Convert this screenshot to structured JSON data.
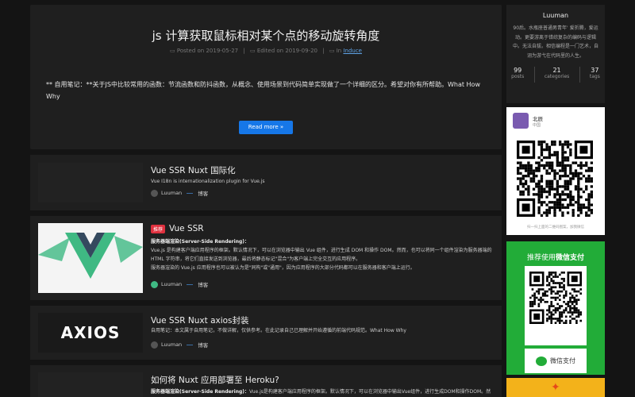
{
  "featured": {
    "title": "js 计算获取鼠标相对某个点的移动旋转角度",
    "posted_label": "Posted on",
    "posted_date": "2019-05-27",
    "edited_label": "Edited on",
    "edited_date": "2019-09-20",
    "in_label": "In",
    "category": "Induce",
    "excerpt": "** 自用笔记：**关于JS中比较常用的函数：节流函数和防抖函数，从概念、使用场景到代码简单实现做了一个详细的区分。希望对你有所帮助。What How Why",
    "more_label": "Read more »"
  },
  "posts": [
    {
      "title": "Vue SSR Nuxt 国际化",
      "subtitle": "Vue I18n is internationalization plugin for Vue.js",
      "author": "Luuman",
      "category": "博客"
    },
    {
      "badge": "推荐",
      "title": "Vue SSR",
      "subtitle_bold": "服务器端渲染(Server-Side Rendering)：",
      "subtitle_lines": [
        "Vue.js 是构建客户端应用程序的框架。默认情况下，可以在浏览器中输出 Vue 组件，进行生成 DOM 和操作 DOM。然而，也可以将同一个组件渲染为服务器端的 HTML 字符串，将它们直接发送到浏览器，最后将静态标记\"混合\"为客户端上完全交互的应用程序。",
        "服务器渲染的 Vue.js 应用程序也可以被认为是\"同构\"或\"通用\"，因为应用程序的大部分代码都可以在服务器和客户端上运行。"
      ],
      "author": "Luuman",
      "category": "博客"
    },
    {
      "title": "Vue SSR Nuxt axios封装",
      "subtitle": "自用笔记：本文属于自用笔记，不做详解，仅供参考。在此记录自己已理解并开始遵循的前端代码规范。What How Why",
      "logo_text": "AXIOS",
      "author": "Luuman",
      "category": "博客"
    },
    {
      "title": "如何将 Nuxt 应用部署至 Heroku?",
      "subtitle_bold": "服务器端渲染(Server-Side Rendering)：",
      "subtitle": "Vue.js是构建客户端应用程序的框架。默认情况下，可以在浏览器中输出Vue组件，进行生成DOM和操作DOM。然"
    }
  ],
  "profile": {
    "name": "Luuman",
    "bio": "90后。水瓶座普通男青年' 爱折腾，爱运动。更要游离于错综复杂的编码与逻辑中。无法自拔。相信编程是一门艺术，自诩为游弋在代码里的人生。",
    "stats": [
      {
        "value": "99",
        "label": "posts"
      },
      {
        "value": "21",
        "label": "categories"
      },
      {
        "value": "37",
        "label": "tags"
      }
    ]
  },
  "wechat": {
    "name": "北辰",
    "location": "中国",
    "footer": "扫一扫上面的二维码图案，加我微信"
  },
  "pay": {
    "title_prefix": "推荐使用",
    "title_bold": "微信支付",
    "footer": "微信支付"
  },
  "colors": {
    "accent": "#1677e8",
    "badge": "#e0313f",
    "wechat_green": "#22ac38"
  }
}
